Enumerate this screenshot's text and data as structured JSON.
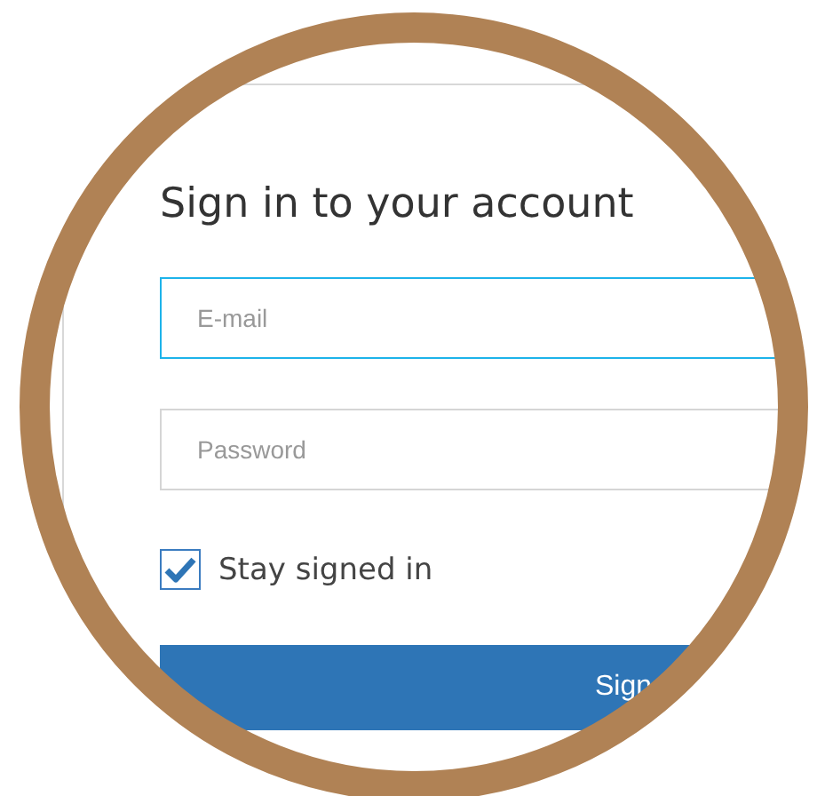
{
  "title": "Sign in to your account",
  "fields": [
    {
      "placeholder": "E-mail",
      "focused": true
    },
    {
      "placeholder": "Password",
      "focused": false
    }
  ],
  "remember": {
    "label": "Stay signed in",
    "checked": true
  },
  "submit": {
    "label": "Sign"
  }
}
